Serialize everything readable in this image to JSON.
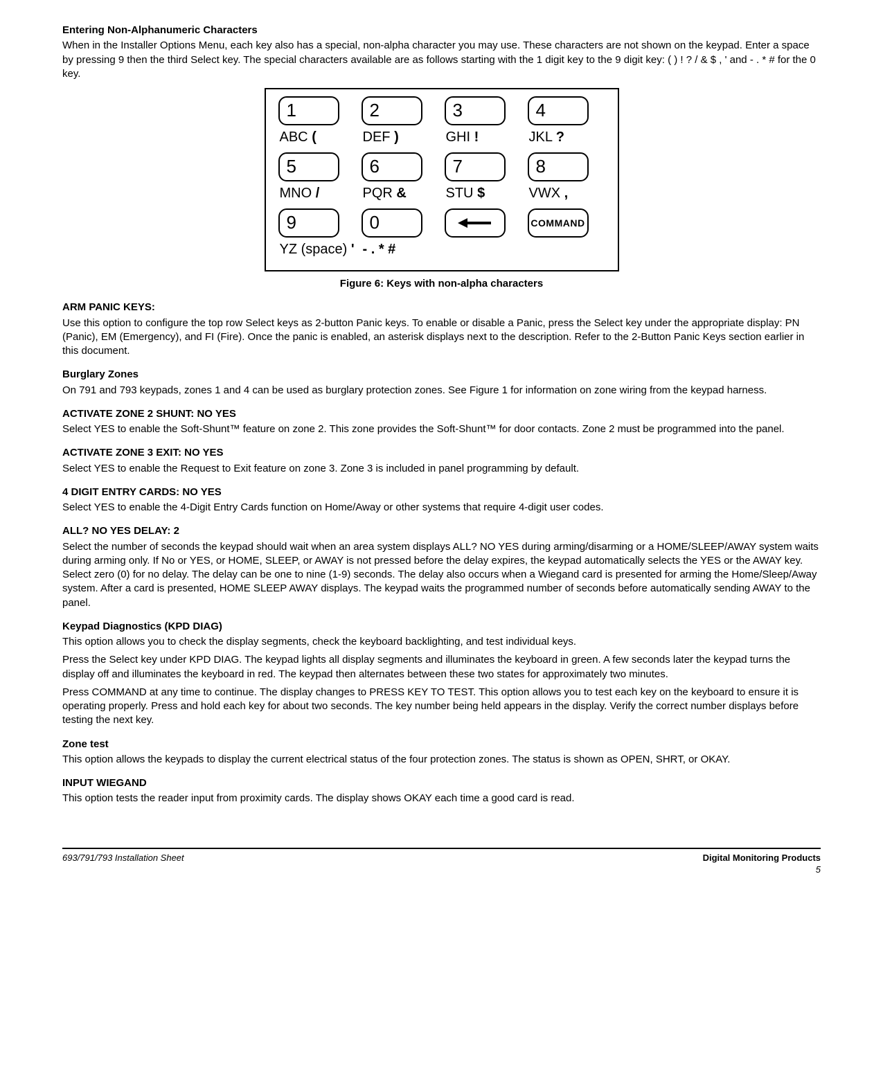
{
  "heading_nonalpha": "Entering Non-Alphanumeric Characters",
  "para_nonalpha": "When in the Installer Options Menu, each key also has a special, non-alpha character you may use.  These characters are not shown on the keypad.  Enter a space by pressing 9 then the third Select key.  The special characters available are as follows starting with the 1 digit key to the 9 digit key: ( ) ! ? / & $ , ' and - . * # for the 0 key.",
  "keypad": {
    "keys": [
      {
        "num": "1",
        "letters": "ABC",
        "special": "("
      },
      {
        "num": "2",
        "letters": "DEF",
        "special": ")"
      },
      {
        "num": "3",
        "letters": "GHI",
        "special": "!"
      },
      {
        "num": "4",
        "letters": "JKL",
        "special": "?"
      },
      {
        "num": "5",
        "letters": "MNO",
        "special": "/"
      },
      {
        "num": "6",
        "letters": "PQR",
        "special": "&"
      },
      {
        "num": "7",
        "letters": "STU",
        "special": "$"
      },
      {
        "num": "8",
        "letters": "VWX",
        "special": ","
      },
      {
        "num": "9",
        "letters": "YZ (space)",
        "special": "'"
      },
      {
        "num": "0",
        "letters": "-  .  *  #",
        "special": ""
      }
    ],
    "command_label": "COMMAND"
  },
  "figure_caption": "Figure 6: Keys with non-alpha characters",
  "heading_armpanic": "ARM PANIC KEYS:",
  "para_armpanic": "Use this option to configure the top row Select keys as 2-button Panic keys.  To enable or disable a Panic, press the Select key under the appropriate display: PN (Panic), EM (Emergency), and FI (Fire).  Once the panic is enabled, an asterisk displays next to the description.  Refer to the 2-Button Panic Keys section earlier in this document.",
  "heading_burg": "Burglary Zones",
  "para_burg": "On 791 and 793 keypads, zones 1 and 4 can be used as burglary protection zones. See Figure 1 for information on zone wiring from the keypad harness.",
  "heading_z2": "ACTIVATE ZONE 2 SHUNT:  NO  YES",
  "para_z2": "Select YES to enable the Soft-Shunt™ feature on zone 2. This zone provides the Soft-Shunt™ for door contacts. Zone 2 must be programmed into the panel.",
  "heading_z3": "ACTIVATE ZONE 3 EXIT:  NO  YES",
  "para_z3": "Select YES to enable the Request to Exit feature on zone 3. Zone 3 is included in panel programming by default.",
  "heading_4digit": "4 DIGIT ENTRY CARDS:  NO  YES",
  "para_4digit": "Select YES to enable the 4-Digit Entry Cards function on Home/Away or other systems that require 4-digit user codes.",
  "heading_all": "ALL?  NO  YES  DELAY:  2",
  "para_all": "Select the number of seconds the keypad should wait when an area system displays  ALL?  NO  YES during arming/disarming or a HOME/SLEEP/AWAY system waits during arming only.  If No or YES, or HOME,  SLEEP, or  AWAY is not pressed before the delay expires, the keypad automatically selects the YES or the AWAY key.  Select zero (0) for no delay.  The delay can be one to nine (1-9) seconds.  The delay also occurs when a Wiegand card is presented for arming the Home/Sleep/Away system.  After a card is presented, HOME  SLEEP  AWAY displays.  The keypad waits the programmed number of seconds before automatically sending AWAY to the panel.",
  "heading_diag": "Keypad Diagnostics (KPD DIAG)",
  "para_diag1": "This option allows you to check the display segments, check the keyboard backlighting, and test individual keys.",
  "para_diag2": "Press the Select key under KPD DIAG.  The keypad lights all display segments and illuminates the keyboard in green.  A few seconds later the keypad turns the display off and illuminates the keyboard in red.  The keypad then alternates between these two states for approximately two minutes.",
  "para_diag3": "Press COMMAND at any time to continue.  The display changes to PRESS KEY TO TEST.  This option allows you to test each key on the keyboard to ensure it is operating properly.  Press and hold each key for about two seconds.  The key number being held appears in the display.  Verify the correct number displays before testing the next key.",
  "heading_zonetest": "Zone test",
  "para_zonetest": "This option allows the keypads to display the current electrical status of the four protection zones.  The status is shown as OPEN, SHRT, or OKAY.",
  "heading_wiegand": "INPUT WIEGAND",
  "para_wiegand": "This option tests the reader input from proximity cards.  The display shows OKAY each time a good card is read.",
  "footer": {
    "left": "693/791/793 Installation Sheet",
    "right": "Digital Monitoring Products",
    "page": "5"
  }
}
